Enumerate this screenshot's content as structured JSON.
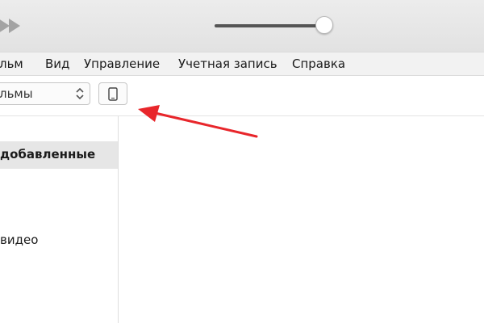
{
  "player": {
    "volume_level": 0.97
  },
  "menu": {
    "items": [
      "льм",
      "Вид",
      "Управление",
      "Учетная запись",
      "Справка"
    ]
  },
  "toolbar": {
    "media_select_value": "льмы",
    "device_button_icon": "phone-device-icon"
  },
  "sidebar": {
    "items": [
      {
        "label": "добавленные",
        "selected": true
      },
      {
        "label": "видео",
        "selected": false
      }
    ]
  },
  "annotation": {
    "arrow_color": "#e8262b",
    "arrow_target": "device-button"
  },
  "colors": {
    "selected_row_bg": "#e6e6e6",
    "toolbar_bg": "#e6e6e6"
  }
}
